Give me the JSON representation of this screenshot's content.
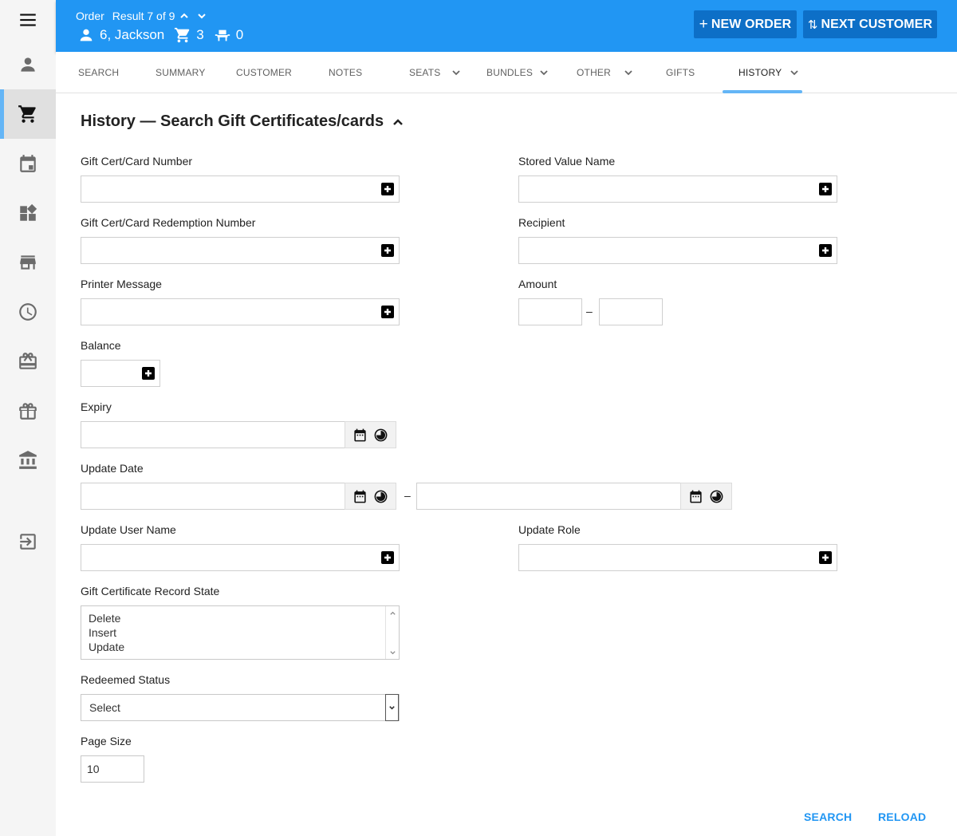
{
  "sidebar": {
    "menu_icon": "hamburger-menu-icon",
    "items": [
      {
        "name": "customer",
        "icon": "person-icon",
        "active": false
      },
      {
        "name": "order",
        "icon": "cart-icon",
        "active": true
      },
      {
        "name": "calendar",
        "icon": "calendar-icon",
        "active": false
      },
      {
        "name": "widgets",
        "icon": "widgets-icon",
        "active": false
      },
      {
        "name": "store",
        "icon": "store-icon",
        "active": false
      },
      {
        "name": "history",
        "icon": "clock-icon",
        "active": false
      },
      {
        "name": "gift-card",
        "icon": "gift-card-icon",
        "active": false
      },
      {
        "name": "gift",
        "icon": "gift-icon",
        "active": false
      },
      {
        "name": "bank",
        "icon": "bank-icon",
        "active": false
      },
      {
        "name": "exit",
        "icon": "exit-icon",
        "active": false
      }
    ]
  },
  "header": {
    "order_label": "Order",
    "result_text": "Result 7 of 9",
    "customer_name": "6, Jackson",
    "cart_count": "3",
    "seat_count": "0",
    "new_order_label": "NEW ORDER",
    "next_customer_label": "NEXT CUSTOMER"
  },
  "tabs": [
    {
      "label": "SEARCH",
      "has_menu": false
    },
    {
      "label": "SUMMARY",
      "has_menu": false
    },
    {
      "label": "CUSTOMER",
      "has_menu": false
    },
    {
      "label": "NOTES",
      "has_menu": false
    },
    {
      "label": "SEATS",
      "has_menu": true
    },
    {
      "label": "BUNDLES",
      "has_menu": true
    },
    {
      "label": "OTHER",
      "has_menu": true
    },
    {
      "label": "GIFTS",
      "has_menu": false
    },
    {
      "label": "HISTORY",
      "has_menu": true,
      "active": true
    }
  ],
  "form": {
    "title": "History — Search Gift Certificates/cards",
    "gift_cert_number": {
      "label": "Gift Cert/Card Number",
      "value": ""
    },
    "stored_value_name": {
      "label": "Stored Value Name",
      "value": ""
    },
    "redemption_number": {
      "label": "Gift Cert/Card Redemption Number",
      "value": ""
    },
    "recipient": {
      "label": "Recipient",
      "value": ""
    },
    "printer_message": {
      "label": "Printer Message",
      "value": ""
    },
    "amount": {
      "label": "Amount",
      "from": "",
      "to": "",
      "separator": "–"
    },
    "balance": {
      "label": "Balance",
      "value": ""
    },
    "expiry": {
      "label": "Expiry",
      "value": ""
    },
    "update_date": {
      "label": "Update Date",
      "from": "",
      "to": "",
      "separator": "–"
    },
    "update_user_name": {
      "label": "Update User Name",
      "value": ""
    },
    "update_role": {
      "label": "Update Role",
      "value": ""
    },
    "record_state": {
      "label": "Gift Certificate Record State",
      "options": [
        "Delete",
        "Insert",
        "Update"
      ]
    },
    "redeemed_status": {
      "label": "Redeemed Status",
      "selected": "Select"
    },
    "page_size": {
      "label": "Page Size",
      "value": "10"
    }
  },
  "actions": {
    "search_label": "SEARCH",
    "reload_label": "RELOAD"
  },
  "colors": {
    "primary": "#2196f3",
    "button_dark": "#0d6fc7",
    "tab_indicator": "#64b5f6"
  }
}
